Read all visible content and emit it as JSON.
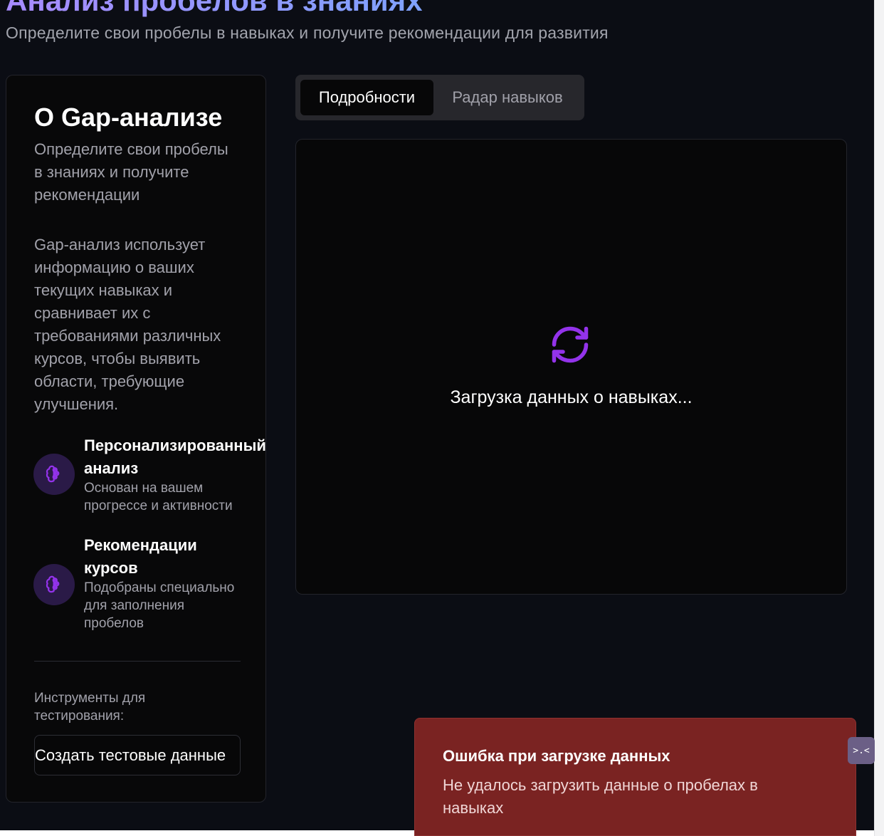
{
  "page": {
    "title": "Анализ пробелов в знаниях",
    "subtitle": "Определите свои пробелы в навыках и получите рекомендации для развития"
  },
  "sidebar": {
    "title": "О Gap-анализе",
    "description": "Определите свои пробелы в знаниях и получите рекомендации",
    "body": "Gap-анализ использует информацию о ваших текущих навыках и сравнивает их с требованиями различных курсов, чтобы выявить области, требующие улучшения.",
    "features": [
      {
        "icon": "brain-icon",
        "title_line1": "Персонализированный",
        "title_line2": "анализ",
        "description": "Основан на вашем прогрессе и активности"
      },
      {
        "icon": "brain-icon",
        "title_line1": "Рекомендации",
        "title_line2": "курсов",
        "description": "Подобраны специально для заполнения пробелов"
      }
    ],
    "tools_label": "Инструменты для тестирования:",
    "create_test_data_label": "Создать тестовые данные"
  },
  "tabs": [
    {
      "label": "Подробности",
      "active": true
    },
    {
      "label": "Радар навыков",
      "active": false
    }
  ],
  "content": {
    "loading_icon": "refresh-icon",
    "loading_text": "Загрузка данных о навыках..."
  },
  "toast": {
    "title": "Ошибка при загрузке данных",
    "message": "Не удалось загрузить данные о пробелах в навыках"
  },
  "floating_button": {
    "icon": "face-icon",
    "glyph": ">.<"
  },
  "colors": {
    "background": "#0b0d14",
    "card": "#070708",
    "accent": "#9333ea",
    "title_gradient_start": "#a88bff",
    "title_gradient_end": "#7fa2ff",
    "error": "#7a2322"
  }
}
